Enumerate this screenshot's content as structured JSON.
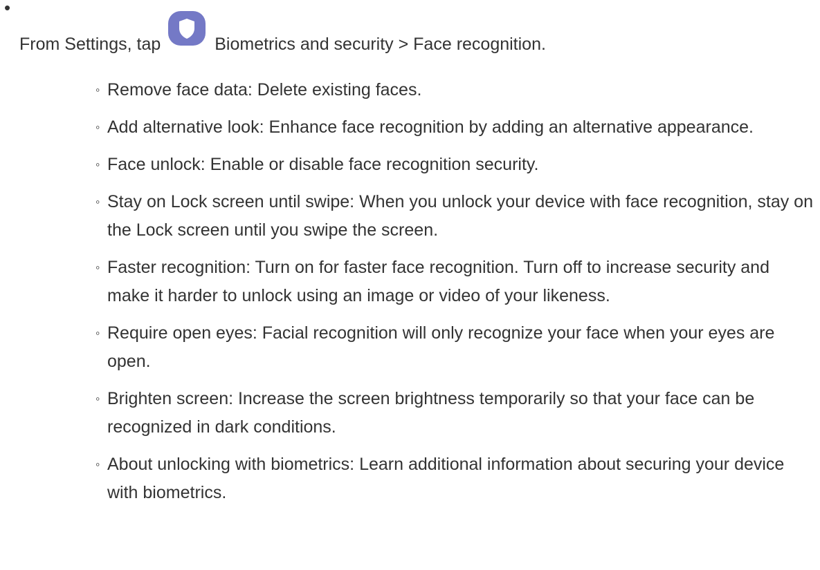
{
  "intro": {
    "before_icon": "From Settings, tap",
    "after_icon": "Biometrics and security > Face recognition.",
    "icon": "shield-icon",
    "icon_colors": {
      "tile": "#7479c6",
      "shield": "#ffffff"
    }
  },
  "options": [
    {
      "text": "Remove face data: Delete existing faces."
    },
    {
      "text": "Add alternative look: Enhance face recognition by adding an alternative appearance."
    },
    {
      "text": "Face unlock: Enable or disable face recognition security."
    },
    {
      "text": "Stay on Lock screen until swipe: When you unlock your device with face recognition, stay on the Lock screen until you swipe the screen."
    },
    {
      "text": "Faster recognition: Turn on for faster face recognition. Turn off to increase security and make it harder to unlock using an image or video of your likeness."
    },
    {
      "text": "Require open eyes: Facial recognition will only recognize your face when your eyes are open."
    },
    {
      "text": "Brighten screen: Increase the screen brightness temporarily so that your face can be recognized in dark conditions."
    },
    {
      "text": "About unlocking with biometrics: Learn additional information about securing your device with biometrics."
    }
  ]
}
